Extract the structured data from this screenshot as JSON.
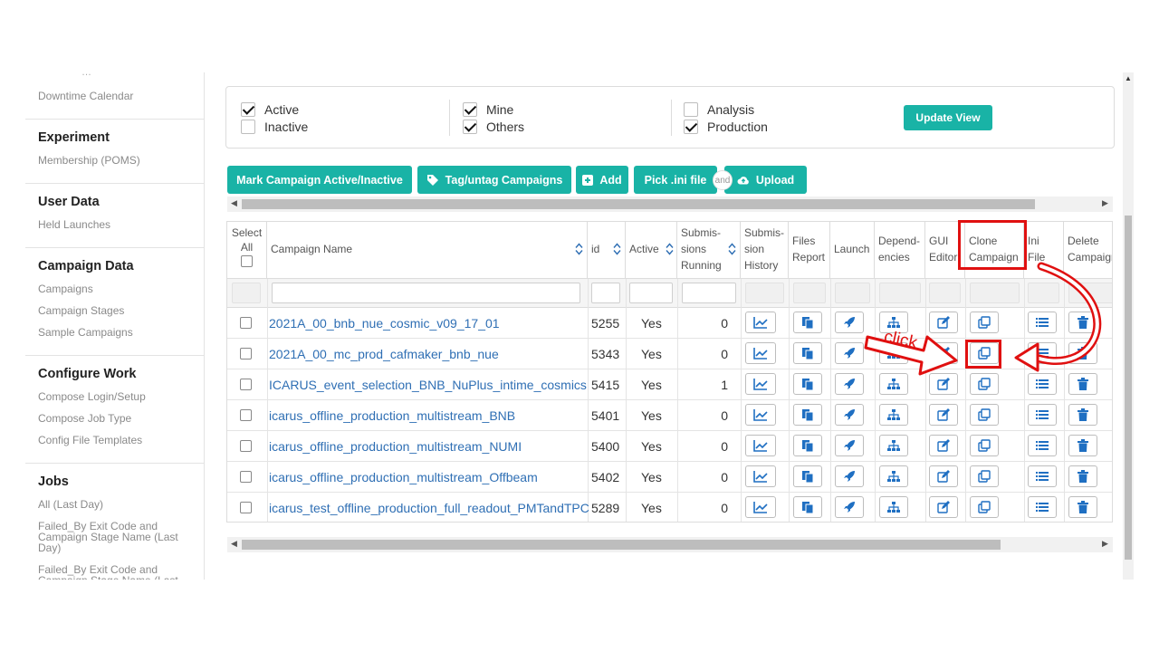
{
  "sidebar": {
    "partial_top": "…",
    "top_item": "Downtime Calendar",
    "sections": [
      {
        "title": "Experiment",
        "items": [
          "Membership (POMS)"
        ]
      },
      {
        "title": "User Data",
        "items": [
          "Held Launches"
        ]
      },
      {
        "title": "Campaign Data",
        "items": [
          "Campaigns",
          "Campaign Stages",
          "Sample Campaigns"
        ]
      },
      {
        "title": "Configure Work",
        "items": [
          "Compose Login/Setup",
          "Compose Job Type",
          "Config File Templates"
        ]
      },
      {
        "title": "Jobs",
        "items": [
          "All (Last Day)",
          "Failed_By Exit Code and Campaign Stage Name (Last Day)",
          "Failed_By Exit Code and Campaign Stage Name (Last"
        ]
      }
    ]
  },
  "filters": {
    "active": {
      "label": "Active",
      "checked": true
    },
    "inactive": {
      "label": "Inactive",
      "checked": false
    },
    "mine": {
      "label": "Mine",
      "checked": true
    },
    "others": {
      "label": "Others",
      "checked": true
    },
    "analysis": {
      "label": "Analysis",
      "checked": false
    },
    "production": {
      "label": "Production",
      "checked": true
    },
    "update_label": "Update View"
  },
  "actions": {
    "mark": "Mark Campaign Active/Inactive",
    "tag": "Tag/untag Campaigns",
    "add": "Add",
    "pick": "Pick .ini file",
    "and": "and",
    "upload": "Upload"
  },
  "table": {
    "headers": {
      "select": [
        "Select",
        "All"
      ],
      "name": [
        "Campaign Name"
      ],
      "id": [
        "id"
      ],
      "active": [
        "Active"
      ],
      "running": [
        "Submis-",
        "sions",
        "Running"
      ],
      "history": [
        "Submis-",
        "sion",
        "History"
      ],
      "files": [
        "Files",
        "Report"
      ],
      "launch": [
        "Launch"
      ],
      "deps": [
        "Depend-",
        "encies"
      ],
      "gui": [
        "GUI",
        "Editor"
      ],
      "clone": [
        "Clone",
        "Campaign"
      ],
      "ini": [
        "Ini",
        "File"
      ],
      "delete": [
        "Delete",
        "Campaign"
      ]
    },
    "rows": [
      {
        "name": "2021A_00_bnb_nue_cosmic_v09_17_01",
        "id": "5255",
        "active": "Yes",
        "running": "0"
      },
      {
        "name": "2021A_00_mc_prod_cafmaker_bnb_nue",
        "id": "5343",
        "active": "Yes",
        "running": "0"
      },
      {
        "name": "ICARUS_event_selection_BNB_NuPlus_intime_cosmics",
        "id": "5415",
        "active": "Yes",
        "running": "1"
      },
      {
        "name": "icarus_offline_production_multistream_BNB",
        "id": "5401",
        "active": "Yes",
        "running": "0"
      },
      {
        "name": "icarus_offline_production_multistream_NUMI",
        "id": "5400",
        "active": "Yes",
        "running": "0"
      },
      {
        "name": "icarus_offline_production_multistream_Offbeam",
        "id": "5402",
        "active": "Yes",
        "running": "0"
      },
      {
        "name": "icarus_test_offline_production_full_readout_PMTandTPC",
        "id": "5289",
        "active": "Yes",
        "running": "0"
      }
    ]
  },
  "annotation": {
    "click_label": "click"
  },
  "icons": [
    "chart-icon",
    "files-icon",
    "rocket-icon",
    "sitemap-icon",
    "edit-icon",
    "clone-icon",
    "list-icon",
    "trash-icon"
  ],
  "colors": {
    "accent": "#19b3a6",
    "link": "#2f6fb4",
    "icon_blue": "#1f6fc2",
    "annotation_red": "#e01010"
  }
}
